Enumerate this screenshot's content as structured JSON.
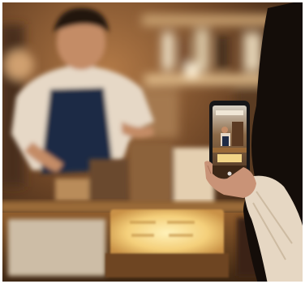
{
  "scene": {
    "colors": {
      "wall_warm": "#8a5a34",
      "wall_dark": "#2a1a10",
      "counter": "#7a4a22",
      "apron": "#1e2a44",
      "shirt": "#e8dccd",
      "skin": "#c98f6a",
      "hair": "#2a1a12",
      "sign_glow": "#f6d98a",
      "phone_body": "#1a1a1e",
      "sweater": "#e9ddcf",
      "viewer_hair": "#1a120e"
    }
  },
  "phone_screen": {
    "icon": "camera-preview-icon"
  }
}
